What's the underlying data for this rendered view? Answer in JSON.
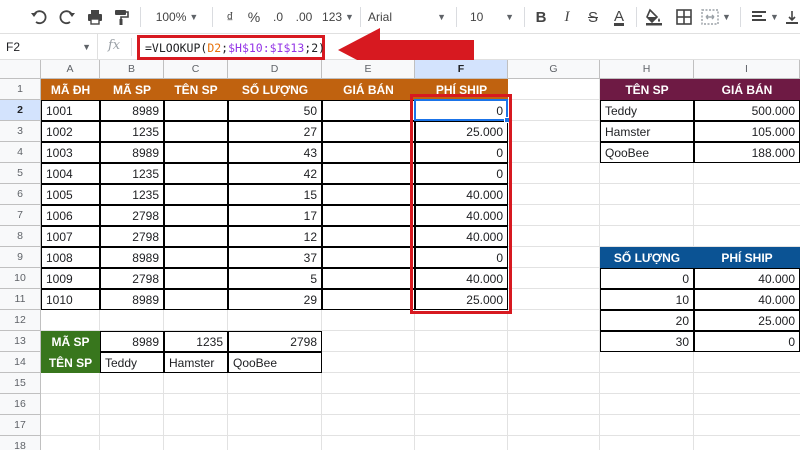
{
  "toolbar": {
    "zoom": "100%",
    "currency_symbol": "₫",
    "percent_symbol": "%",
    "decrease_decimal": ".0",
    "increase_decimal": ".00",
    "number_format": "123",
    "font": "Arial",
    "font_size": "10",
    "bold": "B",
    "italic": "I",
    "strikethrough": "S",
    "text_color": "A"
  },
  "formula_bar": {
    "cell_ref": "F2",
    "fx_label": "fx",
    "formula": {
      "prefix": "=VLOOKUP(",
      "arg1": "D2",
      "sep1": ";",
      "arg2": "$H$10:$I$13",
      "sep2": ";",
      "arg3": "2",
      "suffix": ")"
    }
  },
  "columns": [
    "A",
    "B",
    "C",
    "D",
    "E",
    "F",
    "G",
    "H",
    "I"
  ],
  "rows": [
    "1",
    "2",
    "3",
    "4",
    "5",
    "6",
    "7",
    "8",
    "9",
    "10",
    "11",
    "12",
    "13",
    "14",
    "15",
    "16",
    "17",
    "18"
  ],
  "colors": {
    "main_header": "#c0620f",
    "product_header": "#6e1a44",
    "ship_header": "#0b5394",
    "lookup_header": "#38761d",
    "highlight_red": "#d71920",
    "selection_blue": "#1a73e8"
  },
  "main_table": {
    "headers": [
      "MÃ ĐH",
      "MÃ SP",
      "TÊN SP",
      "SỐ LƯỢNG",
      "GIÁ BÁN",
      "PHÍ SHIP"
    ],
    "rows": [
      [
        "1001",
        "8989",
        "",
        "50",
        "",
        "0"
      ],
      [
        "1002",
        "1235",
        "",
        "27",
        "",
        "25.000"
      ],
      [
        "1003",
        "8989",
        "",
        "43",
        "",
        "0"
      ],
      [
        "1004",
        "1235",
        "",
        "42",
        "",
        "0"
      ],
      [
        "1005",
        "1235",
        "",
        "15",
        "",
        "40.000"
      ],
      [
        "1006",
        "2798",
        "",
        "17",
        "",
        "40.000"
      ],
      [
        "1007",
        "2798",
        "",
        "12",
        "",
        "40.000"
      ],
      [
        "1008",
        "8989",
        "",
        "37",
        "",
        "0"
      ],
      [
        "1009",
        "2798",
        "",
        "5",
        "",
        "40.000"
      ],
      [
        "1010",
        "8989",
        "",
        "29",
        "",
        "25.000"
      ]
    ]
  },
  "lookup_table": {
    "row13": {
      "label": "MÃ SP",
      "values": [
        "8989",
        "1235",
        "2798"
      ]
    },
    "row14": {
      "label": "TÊN SP",
      "values": [
        "Teddy",
        "Hamster",
        "QooBee"
      ]
    }
  },
  "product_table": {
    "headers": [
      "TÊN SP",
      "GIÁ BÁN"
    ],
    "rows": [
      [
        "Teddy",
        "500.000"
      ],
      [
        "Hamster",
        "105.000"
      ],
      [
        "QooBee",
        "188.000"
      ]
    ]
  },
  "ship_table": {
    "headers": [
      "SỐ LƯỢNG",
      "PHÍ SHIP"
    ],
    "rows": [
      [
        "0",
        "40.000"
      ],
      [
        "10",
        "40.000"
      ],
      [
        "20",
        "25.000"
      ],
      [
        "30",
        "0"
      ]
    ]
  }
}
